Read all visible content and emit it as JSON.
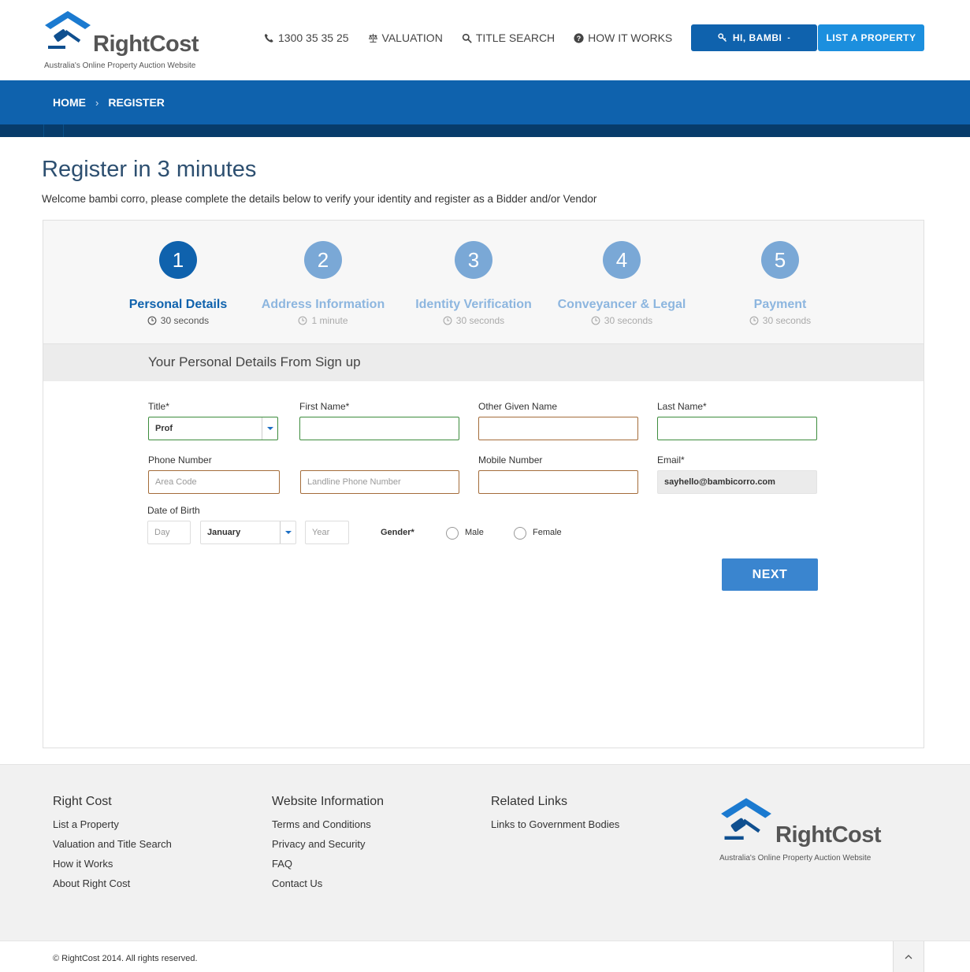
{
  "header": {
    "logo_word": "RightCost",
    "logo_tagline": "Australia's Online Property Auction Website",
    "nav": [
      {
        "label": "1300 35 35 25",
        "icon": "phone-icon"
      },
      {
        "label": "VALUATION",
        "icon": "scales-icon"
      },
      {
        "label": "TITLE SEARCH",
        "icon": "search-icon"
      },
      {
        "label": "HOW IT WORKS",
        "icon": "question-icon"
      }
    ],
    "user_button": "HI, BAMBI",
    "list_button": "LIST A PROPERTY"
  },
  "breadcrumb": {
    "home": "HOME",
    "current": "REGISTER"
  },
  "page": {
    "title": "Register in 3 minutes",
    "subtitle": "Welcome bambi corro, please complete the details below to verify your identity and register as a Bidder and/or Vendor"
  },
  "steps": [
    {
      "num": "1",
      "name": "Personal Details",
      "time": "30 seconds"
    },
    {
      "num": "2",
      "name": "Address Information",
      "time": "1 minute"
    },
    {
      "num": "3",
      "name": "Identity Verification",
      "time": "30 seconds"
    },
    {
      "num": "4",
      "name": "Conveyancer & Legal",
      "time": "30 seconds"
    },
    {
      "num": "5",
      "name": "Payment",
      "time": "30 seconds"
    }
  ],
  "form": {
    "section_title": "Your Personal Details From Sign up",
    "title_label": "Title*",
    "title_value": "Prof",
    "first_name_label": "First Name*",
    "other_name_label": "Other Given Name",
    "last_name_label": "Last Name*",
    "phone_label": "Phone Number",
    "area_code_placeholder": "Area Code",
    "landline_placeholder": "Landline Phone Number",
    "mobile_label": "Mobile Number",
    "email_label": "Email*",
    "email_value": "sayhello@bambicorro.com",
    "dob_label": "Date of Birth",
    "day_placeholder": "Day",
    "month_value": "January",
    "year_placeholder": "Year",
    "gender_label": "Gender*",
    "gender_male": "Male",
    "gender_female": "Female",
    "next_button": "NEXT"
  },
  "footer": {
    "col1_title": "Right Cost",
    "col1_links": [
      "List a Property",
      "Valuation and Title Search",
      "How it Works",
      "About Right Cost"
    ],
    "col2_title": "Website Information",
    "col2_links": [
      "Terms and Conditions",
      "Privacy and Security",
      "FAQ",
      "Contact Us"
    ],
    "col3_title": "Related Links",
    "col3_links": [
      "Links to Government Bodies"
    ],
    "copyright": "© RightCost 2014. All rights reserved."
  },
  "colors": {
    "primary": "#0f62ad",
    "accent": "#1c8fde",
    "step_inactive": "#7aa8d6",
    "next": "#3a85cf"
  }
}
